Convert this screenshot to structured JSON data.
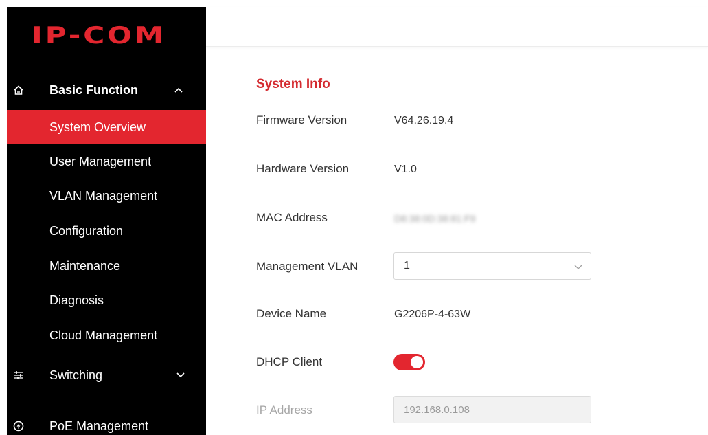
{
  "brand": {
    "logo_text": "IP-COM",
    "accent_color": "#e3262f"
  },
  "sidebar": {
    "sections": [
      {
        "label": "Basic Function",
        "icon": "home-icon",
        "expanded": true
      },
      {
        "label": "Switching",
        "icon": "sliders-icon",
        "expanded": false
      },
      {
        "label": "PoE Management",
        "icon": "power-icon"
      }
    ],
    "items": [
      {
        "label": "System Overview",
        "active": true
      },
      {
        "label": "User Management"
      },
      {
        "label": "VLAN Management"
      },
      {
        "label": "Configuration"
      },
      {
        "label": "Maintenance"
      },
      {
        "label": "Diagnosis"
      },
      {
        "label": "Cloud Management"
      }
    ]
  },
  "main": {
    "section_title": "System Info",
    "firmware": {
      "label": "Firmware Version",
      "value": "V64.26.19.4"
    },
    "hardware": {
      "label": "Hardware Version",
      "value": "V1.0"
    },
    "mac": {
      "label": "MAC Address",
      "value": "D8:38:0D:38:81:F9"
    },
    "mgmt_vlan": {
      "label": "Management VLAN",
      "selected": "1"
    },
    "device_name": {
      "label": "Device Name",
      "value": "G2206P-4-63W"
    },
    "dhcp": {
      "label": "DHCP Client",
      "enabled": true
    },
    "ip": {
      "label": "IP Address",
      "value": "192.168.0.108"
    }
  }
}
